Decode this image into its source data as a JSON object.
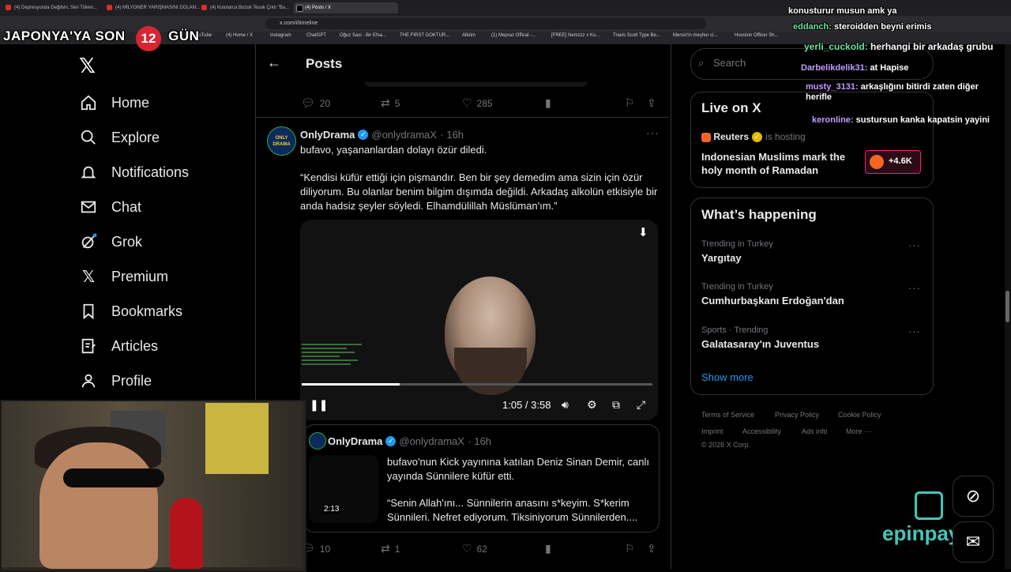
{
  "browser": {
    "tabs": [
      {
        "label": "(4) Depresyonda Değilsin, Sen Tüken..."
      },
      {
        "label": "(4) MİLYONER YARIŞMASINI DOLAN..."
      },
      {
        "label": "(4) Kutularca Bozuk Tesuk Çıktı \"Bu..."
      },
      {
        "label": "(4) Posts / X"
      }
    ],
    "url": "x.com/i/timeline",
    "bookmarks": [
      "ouTube",
      "(4) Home / X",
      "Instagram",
      "ChatGPT",
      "Oğuz Sasi - Bir Efsa...",
      "THE FIRST GOKTUR...",
      "Albüm",
      "(1) Mepraz Offical -...",
      "[FREE] Nemzzz x Ko...",
      "Travis Scott Type Be...",
      "Mersin'in meşhur ci...",
      "Houston Officer Sh..."
    ]
  },
  "overlay": {
    "countdown_text": "JAPONYA'YA SON",
    "countdown_number": "12",
    "countdown_suffix": "GÜN",
    "brand": "epinpay"
  },
  "stream_chat": [
    {
      "user": "",
      "msg": "konusturur musun amk ya"
    },
    {
      "user": "eddanch:",
      "msg": "steroidden beyni erimis"
    },
    {
      "user": "yerli_cuckold:",
      "msg": "herhangi bir arkadaş grubu"
    },
    {
      "user": "Darbelikdelik31:",
      "msg": "at Hapise"
    },
    {
      "user": "musty_3131:",
      "msg": "arkaşlığını bitirdi zaten diğer herifle"
    },
    {
      "user": "keronline:",
      "msg": "sustursun kanka kapatsin yayini"
    }
  ],
  "nav": {
    "items": [
      {
        "label": "Home",
        "icon": "home-icon"
      },
      {
        "label": "Explore",
        "icon": "search-icon"
      },
      {
        "label": "Notifications",
        "icon": "bell-icon"
      },
      {
        "label": "Chat",
        "icon": "mail-icon"
      },
      {
        "label": "Grok",
        "icon": "grok-icon"
      },
      {
        "label": "Premium",
        "icon": "x-logo-icon"
      },
      {
        "label": "Bookmarks",
        "icon": "bookmark-icon"
      },
      {
        "label": "Articles",
        "icon": "article-icon"
      },
      {
        "label": "Profile",
        "icon": "person-icon"
      }
    ]
  },
  "header": {
    "title": "Posts"
  },
  "prev_tweet": {
    "replies": "20",
    "retweets": "5",
    "likes": "285"
  },
  "tweet1": {
    "name": "OnlyDrama",
    "handle": "@onlydramaX",
    "time": "· 16h",
    "avatar_text": "ONLY DRAMA",
    "text": "bufavo, yaşananlardan dolayı özür diledi.",
    "quote": "“Kendisi küfür ettiği için pişmandır. Ben bir şey demedim ama sizin için özür diliyorum. Bu olanlar benim bilgim dışımda değildi. Arkadaş alkolün etkisiyle bir anda hadsiz şeyler söyledi. Elhamdülillah Müslüman'ım.”",
    "video": {
      "time": "1:05 / 3:58",
      "progress": 0.28
    }
  },
  "tweet2": {
    "name": "OnlyDrama",
    "handle": "@onlydramaX",
    "time": "· 16h",
    "thumb_time": "2:13",
    "text": "bufavo'nun Kick yayınına katılan Deniz Sinan Demir, canlı yayında Sünnilere küfür etti.",
    "quote": "“Senin Allah'ını... Sünnilerin anasını s*keyim. S*kerim Sünnileri. Nefret ediyorum. Tiksiniyorum Sünnilerden....",
    "replies": "10",
    "retweets": "1",
    "likes": "62"
  },
  "right": {
    "search_placeholder": "Search",
    "live": {
      "title": "Live on X",
      "host": "Reuters",
      "hosting": "is hosting",
      "headline": "Indonesian Muslims mark the holy month of Ramadan",
      "count": "+4.6K"
    },
    "happening": {
      "title": "What’s happening",
      "trends": [
        {
          "context": "Trending in Turkey",
          "name": "Yargıtay"
        },
        {
          "context": "Trending in Turkey",
          "name": "Cumhurbaşkanı Erdoğan'dan"
        },
        {
          "context": "Sports · Trending",
          "name": "Galatasaray'ın Juventus"
        }
      ],
      "show_more": "Show more"
    },
    "footer": [
      "Terms of Service",
      "Privacy Policy",
      "Cookie Policy",
      "Imprint",
      "Accessibility",
      "Ads info",
      "More ···",
      "© 2026 X Corp."
    ]
  },
  "colors": {
    "accent": "#1d9bf0",
    "live": "#f91880",
    "brand": "#43c6b9",
    "badge": "#d72632"
  }
}
